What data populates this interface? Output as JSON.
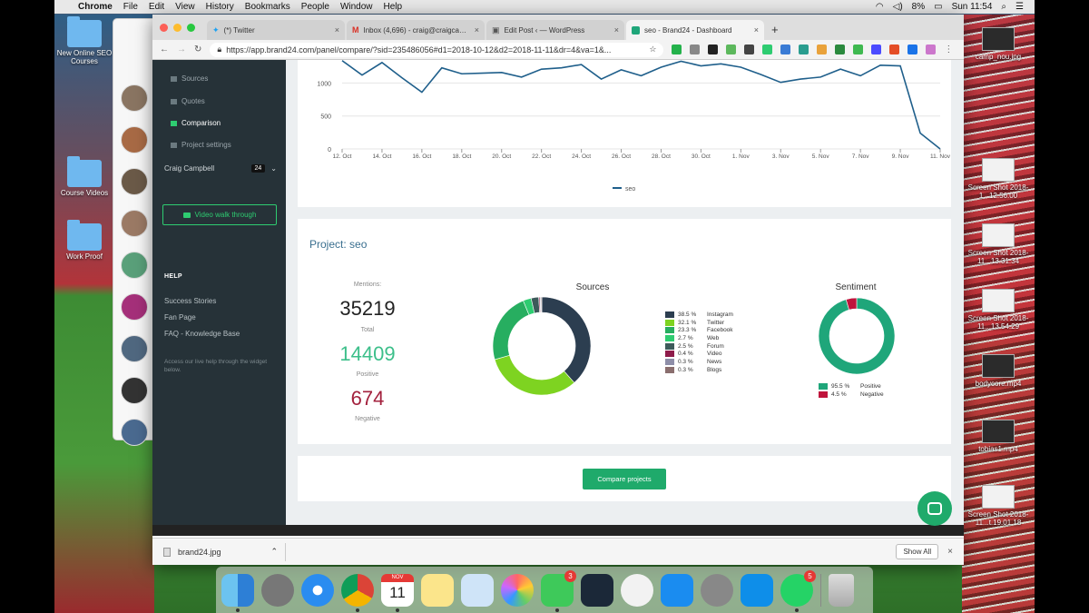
{
  "menubar": {
    "app": "Chrome",
    "items": [
      "File",
      "Edit",
      "View",
      "History",
      "Bookmarks",
      "People",
      "Window",
      "Help"
    ],
    "battery": "8%",
    "clock": "Sun 11:54"
  },
  "desktop": {
    "left_icons": [
      "New Online SEO Courses",
      "Course Videos",
      "Work Proof"
    ],
    "right_icons": [
      "camp_nou.jpg",
      "Screen Shot 2018-1...12.56.00",
      "Screen Shot 2018-11...13.31.34",
      "Screen Shot 2018-11...13.54.29",
      "bodycore.mp4",
      "tobias1.mp4",
      "Screen Shot 2018-11...t.19.01.18"
    ]
  },
  "browser": {
    "tabs": [
      {
        "title": "(*) Twitter",
        "icon": "twitter-icon"
      },
      {
        "title": "Inbox (4,696) - craig@craigcampbell.co.uk",
        "icon": "gmail-icon"
      },
      {
        "title": "Edit Post ‹ — WordPress",
        "icon": "wordpress-icon"
      },
      {
        "title": "seo - Brand24 - Dashboard",
        "icon": "brand24-icon"
      }
    ],
    "url": "https://app.brand24.com/panel/compare/?sid=235486056#d1=2018-10-12&d2=2018-11-11&dr=4&va=1&..."
  },
  "sidebar": {
    "nav": [
      "Sources",
      "Quotes",
      "Comparison",
      "Project settings"
    ],
    "active": "Comparison",
    "user_name": "Craig Campbell",
    "user_badge": "24",
    "walkthrough": "Video walk through",
    "help_title": "HELP",
    "help_links": [
      "Success Stories",
      "Fan Page",
      "FAQ - Knowledge Base"
    ],
    "help_note": "Access our live help through the widget below."
  },
  "chart_data": [
    {
      "type": "line",
      "x": [
        "12. Oct",
        "13. Oct",
        "14. Oct",
        "15. Oct",
        "16. Oct",
        "17. Oct",
        "18. Oct",
        "19. Oct",
        "20. Oct",
        "21. Oct",
        "22. Oct",
        "23. Oct",
        "24. Oct",
        "25. Oct",
        "26. Oct",
        "27. Oct",
        "28. Oct",
        "29. Oct",
        "30. Oct",
        "31. Oct",
        "1. Nov",
        "2. Nov",
        "3. Nov",
        "4. Nov",
        "5. Nov",
        "6. Nov",
        "7. Nov",
        "8. Nov",
        "9. Nov",
        "10. Nov",
        "11. Nov"
      ],
      "x_tick_labels": [
        "12. Oct",
        "14. Oct",
        "16. Oct",
        "18. Oct",
        "20. Oct",
        "22. Oct",
        "24. Oct",
        "26. Oct",
        "28. Oct",
        "30. Oct",
        "1. Nov",
        "3. Nov",
        "5. Nov",
        "7. Nov",
        "9. Nov",
        "11. Nov"
      ],
      "y_ticks": [
        0,
        500,
        1000
      ],
      "ylim": [
        0,
        1350
      ],
      "series": [
        {
          "name": "seo",
          "values": [
            1340,
            1120,
            1310,
            1080,
            860,
            1230,
            1140,
            1150,
            1160,
            1090,
            1210,
            1230,
            1280,
            1060,
            1200,
            1110,
            1240,
            1330,
            1260,
            1290,
            1240,
            1130,
            1010,
            1060,
            1090,
            1210,
            1110,
            1270,
            1260,
            240,
            0
          ]
        }
      ],
      "legend": "bottom-center",
      "grid": true
    },
    {
      "type": "pie",
      "title": "Sources",
      "labels": [
        "Instagram",
        "Twitter",
        "Facebook",
        "Web",
        "Forum",
        "Video",
        "News",
        "Blogs"
      ],
      "percent_labels": [
        "38.5 %",
        "32.1 %",
        "23.3 %",
        "2.7 %",
        "2.5 %",
        "0.4 %",
        "0.3 %",
        "0.3 %"
      ],
      "values": [
        38.5,
        32.1,
        23.3,
        2.7,
        2.5,
        0.4,
        0.3,
        0.3
      ],
      "colors": [
        "#2c3e50",
        "#7ed321",
        "#27ae60",
        "#2ecc71",
        "#3d5a5a",
        "#8e1b4a",
        "#8e8ea8",
        "#8a6e6e"
      ],
      "legend": "right"
    },
    {
      "type": "pie",
      "title": "Sentiment",
      "labels": [
        "Positive",
        "Negative"
      ],
      "percent_labels": [
        "95.5 %",
        "4.5 %"
      ],
      "values": [
        95.5,
        4.5
      ],
      "colors": [
        "#1fa67a",
        "#c0143c"
      ],
      "legend": "bottom"
    }
  ],
  "project": {
    "title": "Project: seo",
    "mentions_label": "Mentions:",
    "total": "35219",
    "total_label": "Total",
    "positive": "14409",
    "positive_label": "Positive",
    "negative": "674",
    "negative_label": "Negative"
  },
  "compare_button": "Compare projects",
  "download": {
    "file": "brand24.jpg",
    "show_all": "Show All"
  },
  "dock": {
    "badges": {
      "messages": "3",
      "whatsapp": "5"
    },
    "calendar_month": "NOV",
    "calendar_day": "11"
  }
}
